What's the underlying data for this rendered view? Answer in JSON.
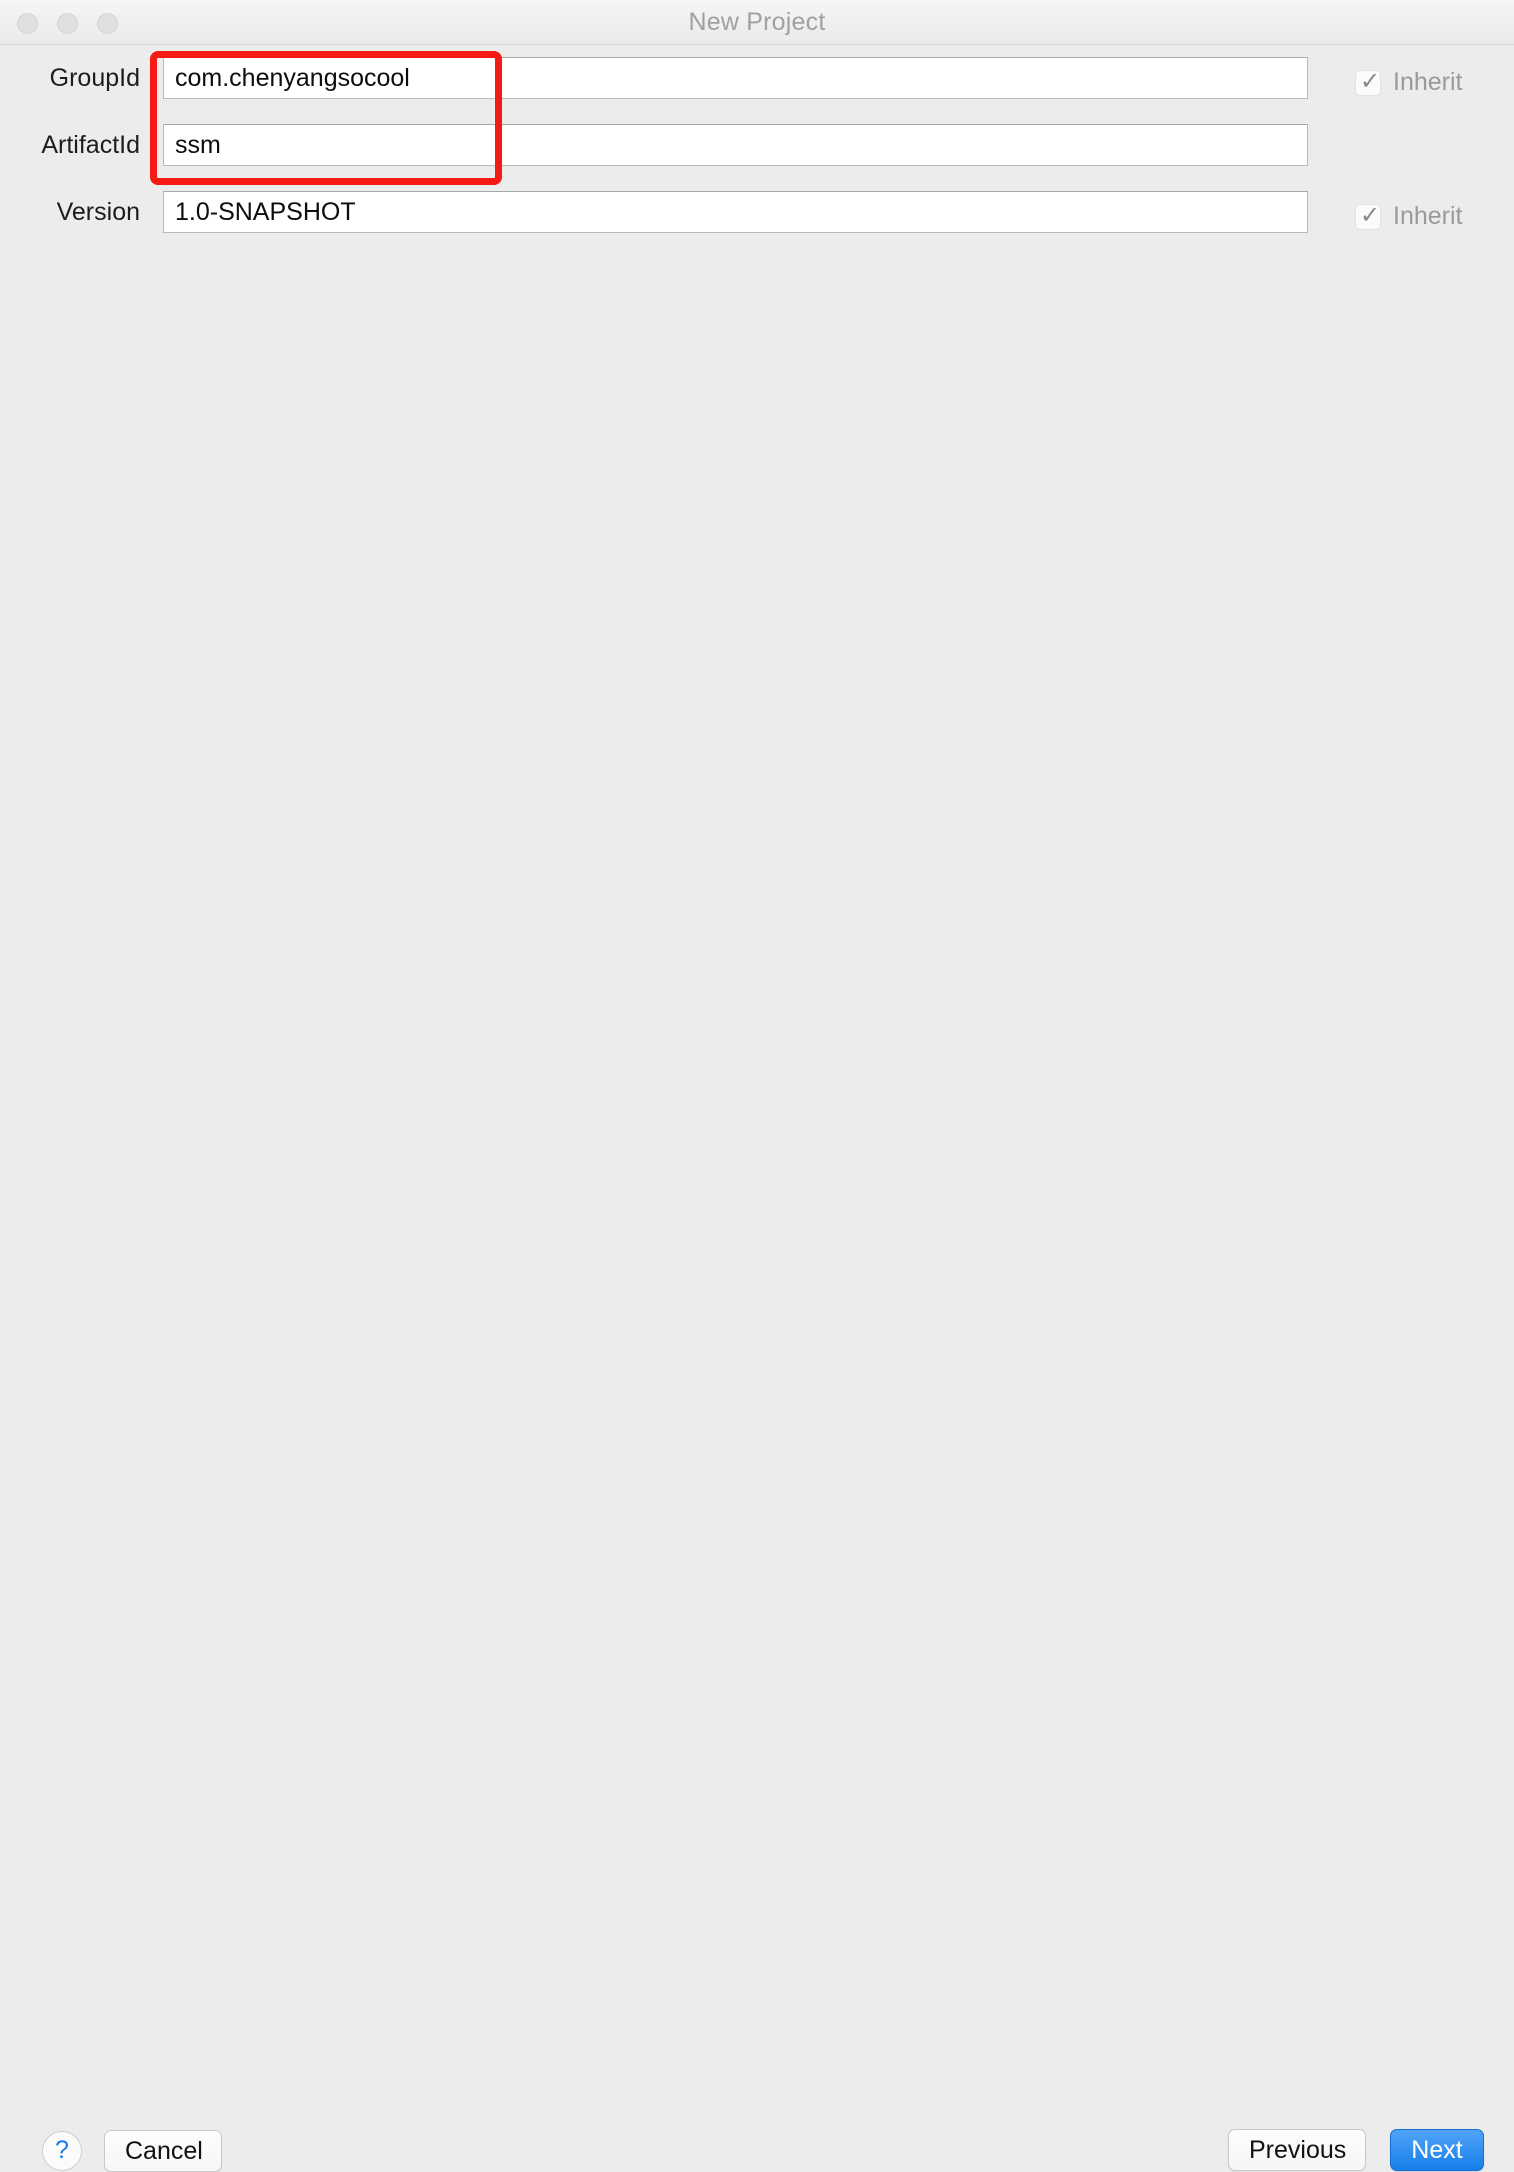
{
  "window": {
    "title": "New Project",
    "traffic_lights": [
      "close",
      "minimize",
      "zoom"
    ]
  },
  "form": {
    "rows": [
      {
        "label": "GroupId",
        "value": "com.chenyangsocool",
        "inherit": {
          "visible": true,
          "label": "Inherit",
          "checked": true
        }
      },
      {
        "label": "ArtifactId",
        "value": "ssm",
        "inherit": {
          "visible": false,
          "label": "",
          "checked": false
        }
      },
      {
        "label": "Version",
        "value": "1.0-SNAPSHOT",
        "inherit": {
          "visible": true,
          "label": "Inherit",
          "checked": true
        }
      }
    ],
    "checkmark_glyph": "✓"
  },
  "annotation": {
    "color": "#f51a14",
    "covers": [
      "GroupId",
      "ArtifactId"
    ]
  },
  "footer": {
    "help_label": "?",
    "cancel_label": "Cancel",
    "previous_label": "Previous",
    "next_label": "Next",
    "accent_color": "#157fea"
  }
}
